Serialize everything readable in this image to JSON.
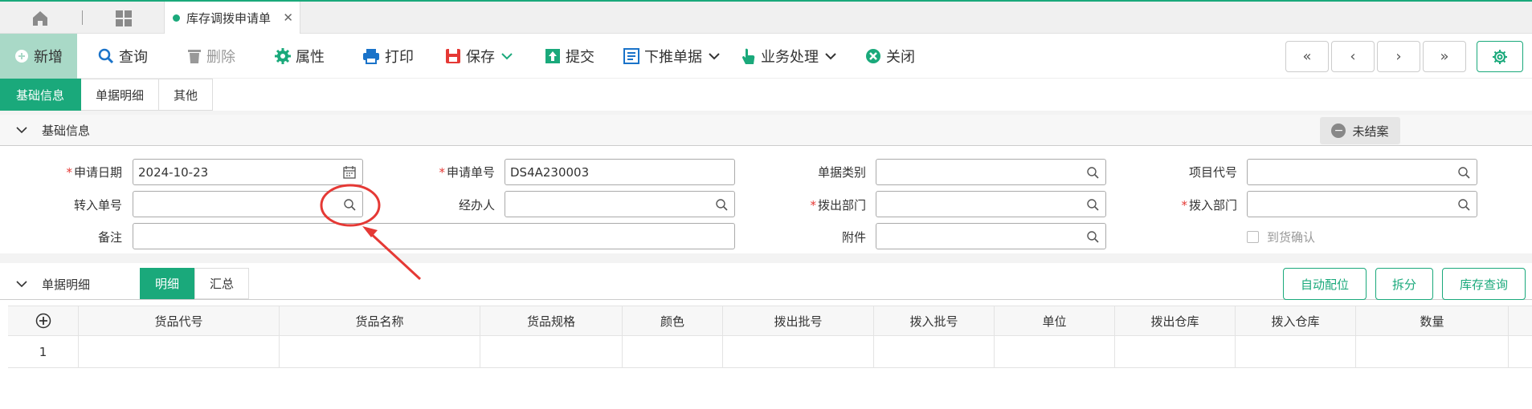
{
  "topbar": {
    "tab_label": "库存调拨申请单",
    "close_glyph": "✕"
  },
  "toolbar": {
    "new_label": "新增",
    "query_label": "查询",
    "delete_label": "删除",
    "property_label": "属性",
    "print_label": "打印",
    "save_label": "保存",
    "submit_label": "提交",
    "push_label": "下推单据",
    "business_label": "业务处理",
    "close_label": "关闭",
    "nav_first": "«",
    "nav_prev": "‹",
    "nav_next": "›",
    "nav_last": "»"
  },
  "subtabs": [
    "基础信息",
    "单据明细",
    "其他"
  ],
  "basic_section": {
    "title": "基础信息",
    "status": "未结案"
  },
  "form": {
    "apply_date_label": "申请日期",
    "apply_date_value": "2024-10-23",
    "apply_no_label": "申请单号",
    "apply_no_value": "DS4A230003",
    "doc_type_label": "单据类别",
    "project_code_label": "项目代号",
    "transfer_in_no_label": "转入单号",
    "handler_label": "经办人",
    "out_dept_label": "拨出部门",
    "in_dept_label": "拨入部门",
    "remark_label": "备注",
    "attachment_label": "附件",
    "arrival_confirm_label": "到货确认"
  },
  "detail_section": {
    "title": "单据明细",
    "toggle_detail": "明细",
    "toggle_summary": "汇总",
    "auto_locate": "自动配位",
    "split": "拆分",
    "stock_query": "库存查询"
  },
  "table": {
    "add_glyph": "⊕",
    "columns": [
      "货品代号",
      "货品名称",
      "货品规格",
      "颜色",
      "拨出批号",
      "拨入批号",
      "单位",
      "拨出仓库",
      "拨入仓库",
      "数量"
    ],
    "rows": [
      {
        "index": "1"
      }
    ]
  },
  "colors": {
    "accent": "#1aa97b",
    "required": "#e53935",
    "annotation": "#e53935"
  }
}
